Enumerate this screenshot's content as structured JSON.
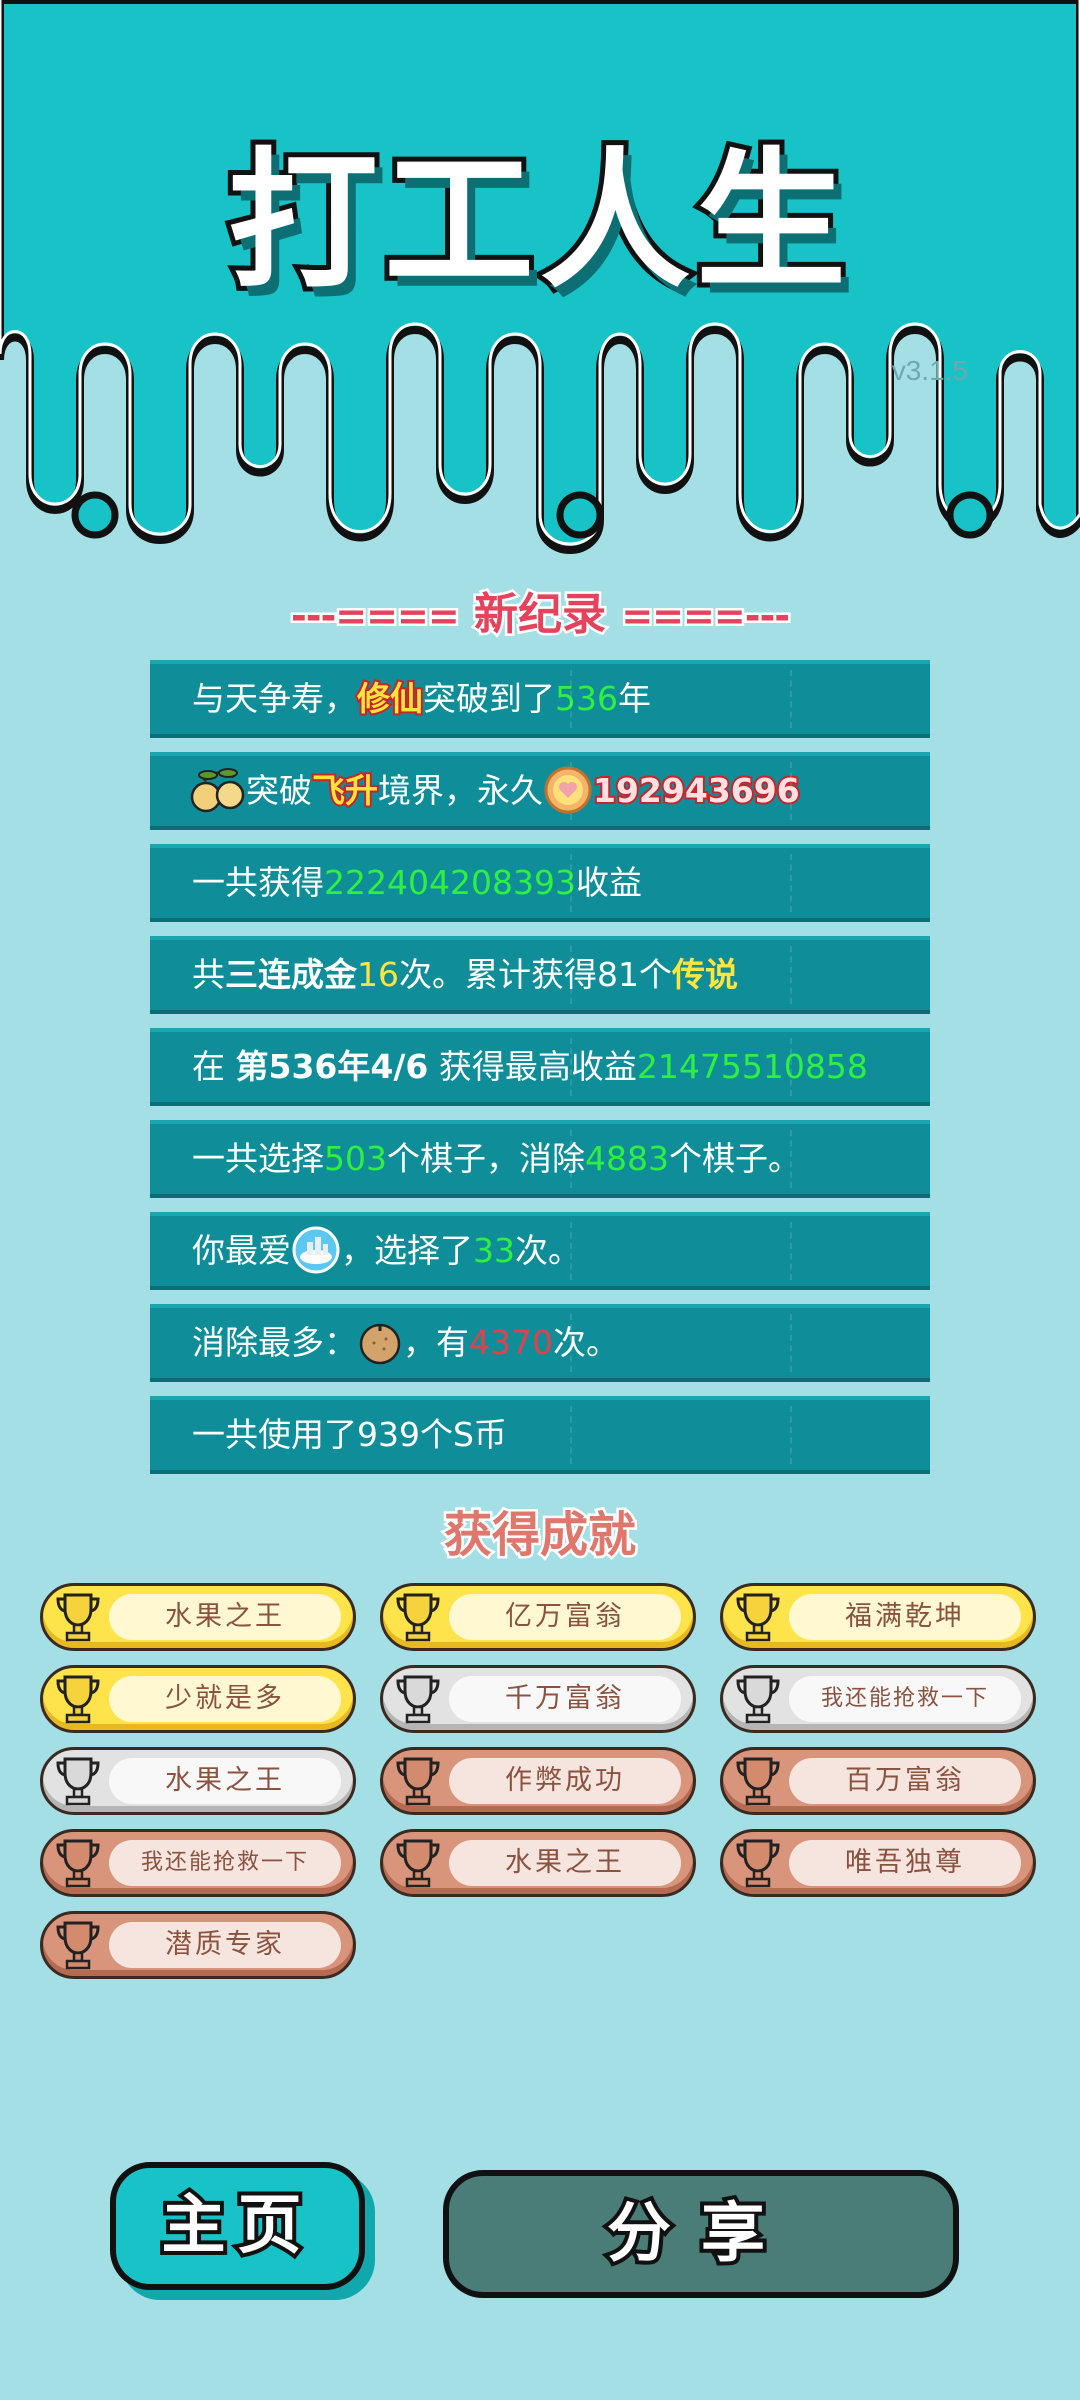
{
  "header": {
    "title": "打工人生",
    "version": "v3.1.5"
  },
  "record": {
    "heading": "新纪录",
    "heading_left_deco": "---====",
    "heading_right_deco": "====---",
    "rows": {
      "r1": {
        "a": "与天争寿，",
        "b": "修仙",
        "c": "突破到了",
        "d": "536",
        "e": "年"
      },
      "r2": {
        "a": "突破",
        "b": "飞升",
        "c": "境界，永久",
        "d": "192943696"
      },
      "r3": {
        "a": "一共获得",
        "b": "222404208393",
        "c": "收益"
      },
      "r4": {
        "a": "共",
        "b": "三连成金",
        "c": "16",
        "d": "次。累计获得81个",
        "e": "传说"
      },
      "r5": {
        "a": "在 ",
        "b": "第536年4/6",
        "c": " 获得最高收益",
        "d": "21475510858"
      },
      "r6": {
        "a": "一共选择",
        "b": "503",
        "c": "个棋子，消除",
        "d": "4883",
        "e": "个棋子。"
      },
      "r7": {
        "a": "你最爱",
        "b": "，选择了",
        "c": "33",
        "d": "次。"
      },
      "r8": {
        "a": "消除最多：",
        "b": "，有",
        "c": "4370",
        "d": "次。"
      },
      "r9": {
        "a": "一共使用了939个S币"
      }
    }
  },
  "achievements": {
    "heading": "获得成就",
    "items": [
      {
        "label": "水果之王",
        "tier": "gold"
      },
      {
        "label": "亿万富翁",
        "tier": "gold"
      },
      {
        "label": "福满乾坤",
        "tier": "gold"
      },
      {
        "label": "少就是多",
        "tier": "gold"
      },
      {
        "label": "千万富翁",
        "tier": "silver"
      },
      {
        "label": "我还能抢救一下",
        "tier": "silver"
      },
      {
        "label": "水果之王",
        "tier": "silver"
      },
      {
        "label": "作弊成功",
        "tier": "bronze"
      },
      {
        "label": "百万富翁",
        "tier": "bronze"
      },
      {
        "label": "我还能抢救一下",
        "tier": "bronze"
      },
      {
        "label": "水果之王",
        "tier": "bronze"
      },
      {
        "label": "唯吾独尊",
        "tier": "bronze"
      },
      {
        "label": "潜质专家",
        "tier": "bronze"
      }
    ]
  },
  "buttons": {
    "home": "主页",
    "share": "分享"
  },
  "colors": {
    "teal": "#17c3c7",
    "background": "#a5dfe6",
    "row": "#0f8e9a",
    "green_value": "#2ef03f",
    "yellow_value": "#ffe540",
    "red_value": "#e2414a"
  },
  "icons": {
    "r2": "peach-pair-icon",
    "coin": "heart-coin-icon",
    "favorite": "sky-city-icon",
    "most_removed": "nut-icon",
    "trophy": "trophy-icon"
  }
}
